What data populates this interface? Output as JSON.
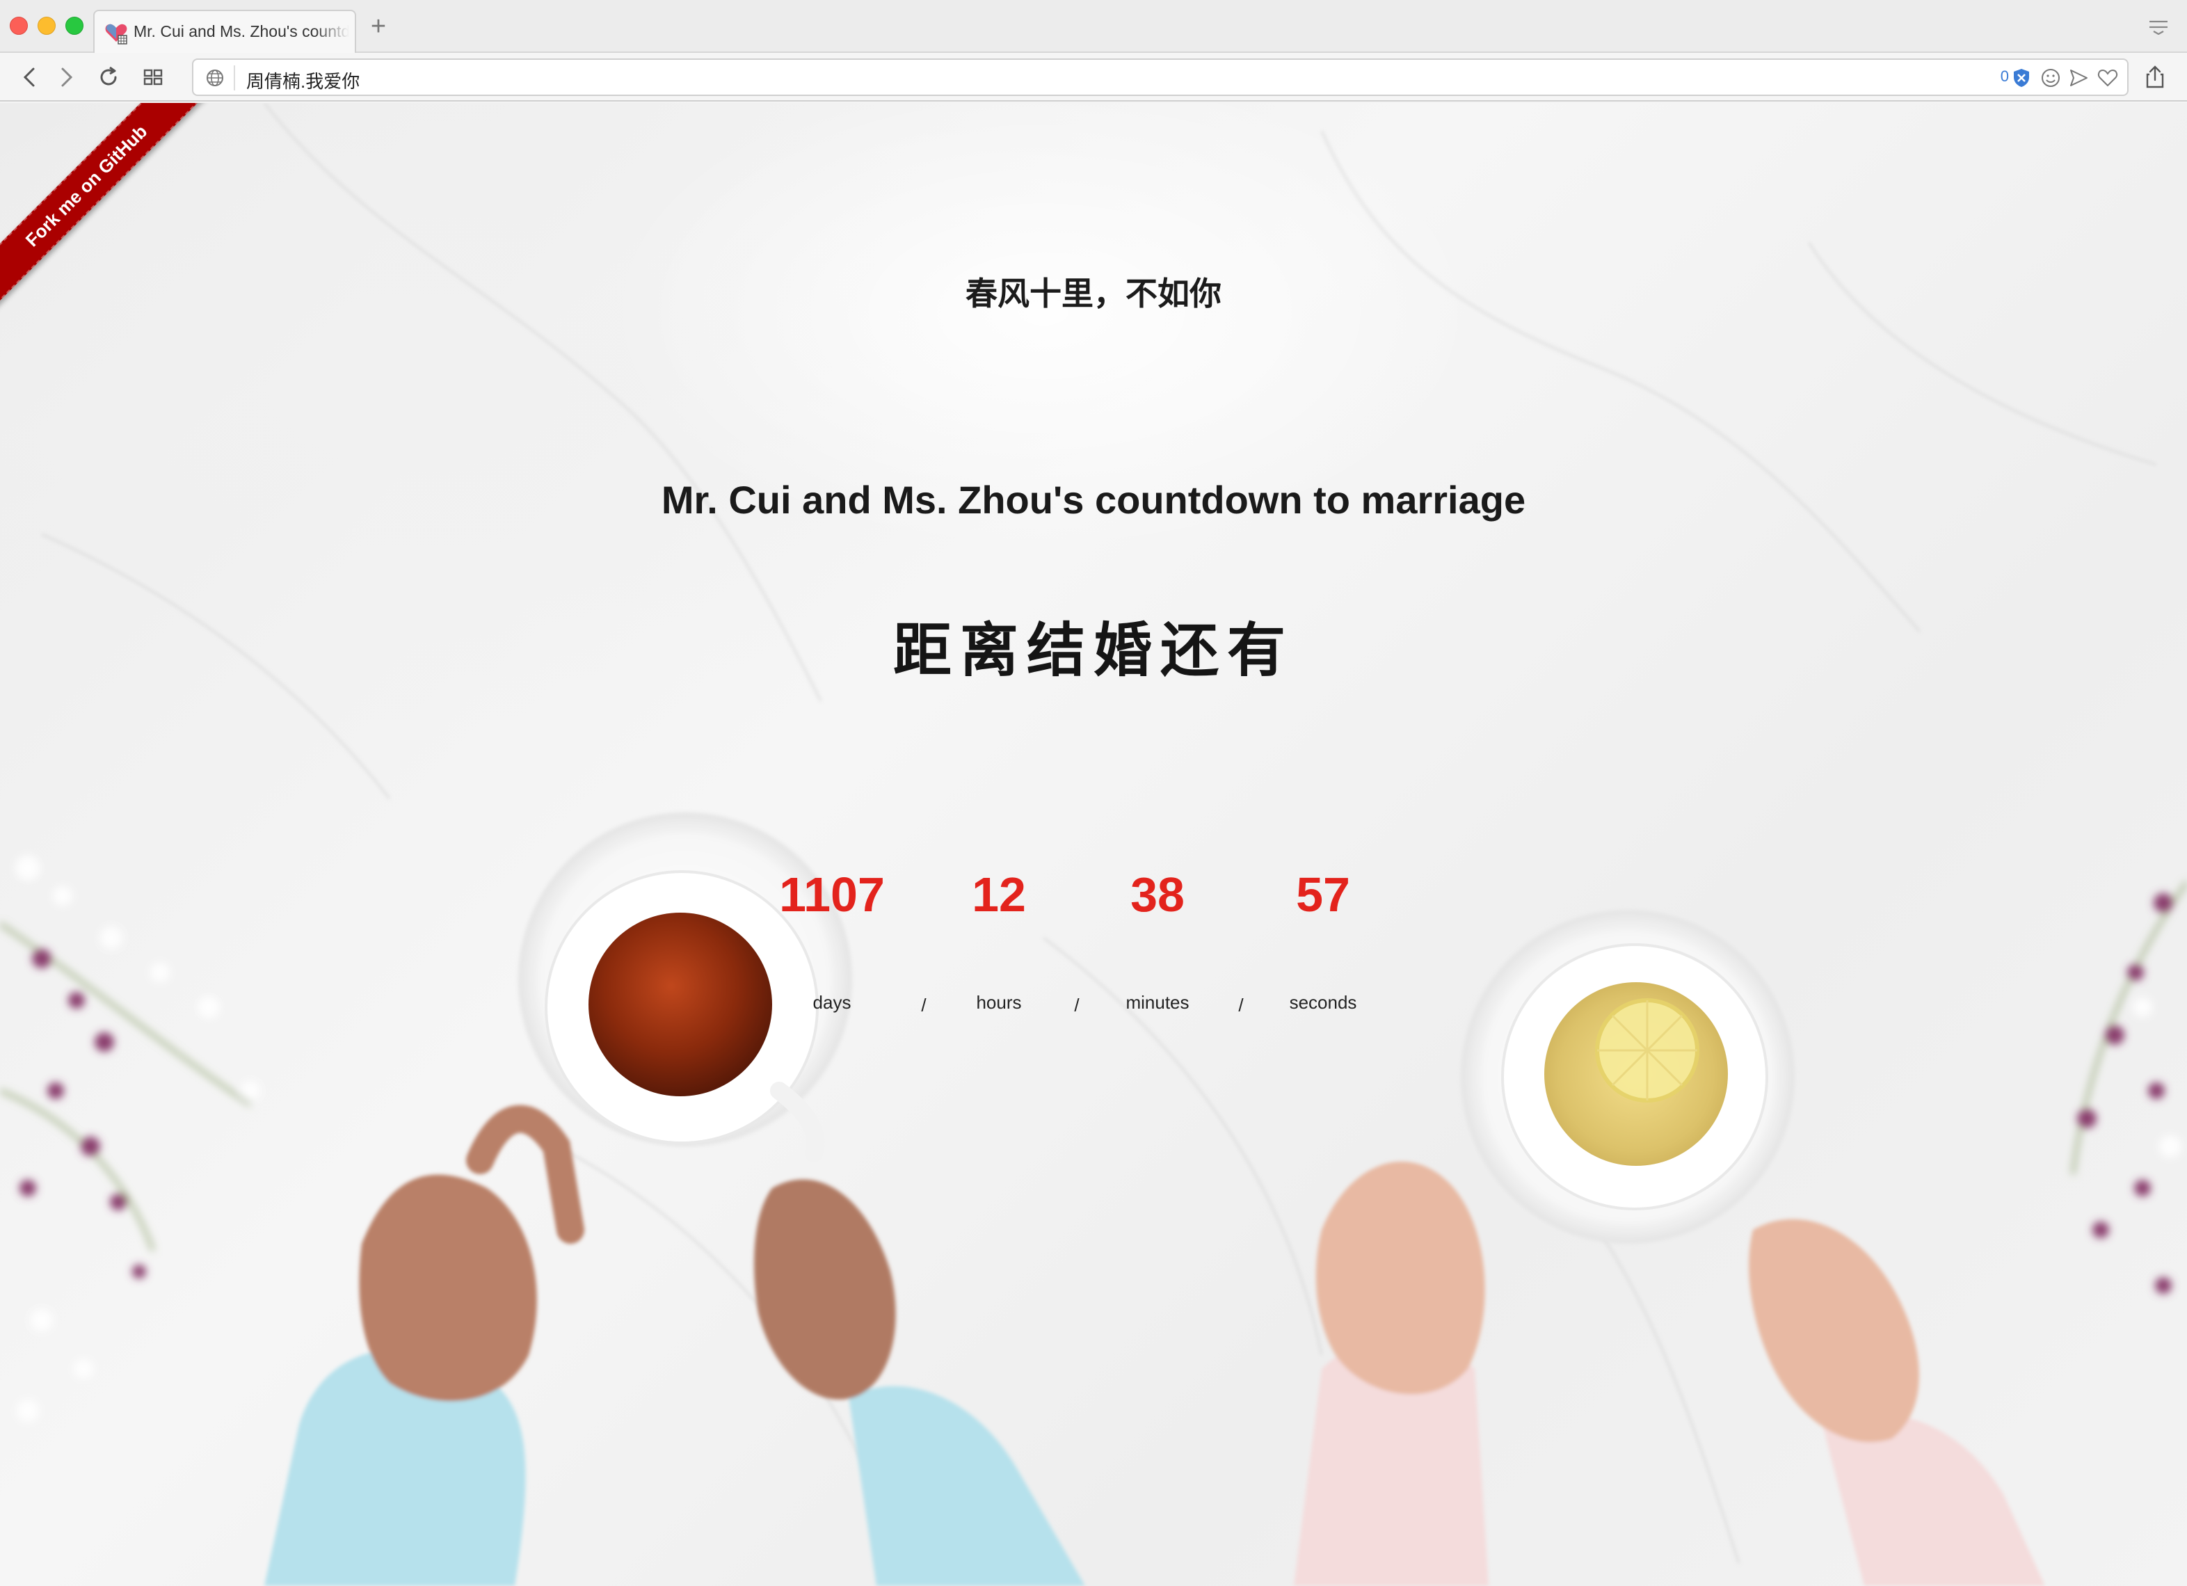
{
  "browser": {
    "tab_title": "Mr. Cui and Ms. Zhou's countdown to marriage",
    "new_tab_label": "+",
    "url": "周倩楠.我爱你",
    "shield_count": "0"
  },
  "ribbon": {
    "label": "Fork me on GitHub"
  },
  "hero": {
    "poem": "春风十里，不如你",
    "title_en": "Mr. Cui and Ms. Zhou's countdown to marriage",
    "title_cn": "距离结婚还有"
  },
  "countdown": {
    "units": [
      {
        "value": "1107",
        "label": "days"
      },
      {
        "value": "12",
        "label": "hours"
      },
      {
        "value": "38",
        "label": "minutes"
      },
      {
        "value": "57",
        "label": "seconds"
      }
    ],
    "separator": "/"
  },
  "colors": {
    "countdown_accent": "#e3231c",
    "ribbon": "#aa0000"
  }
}
